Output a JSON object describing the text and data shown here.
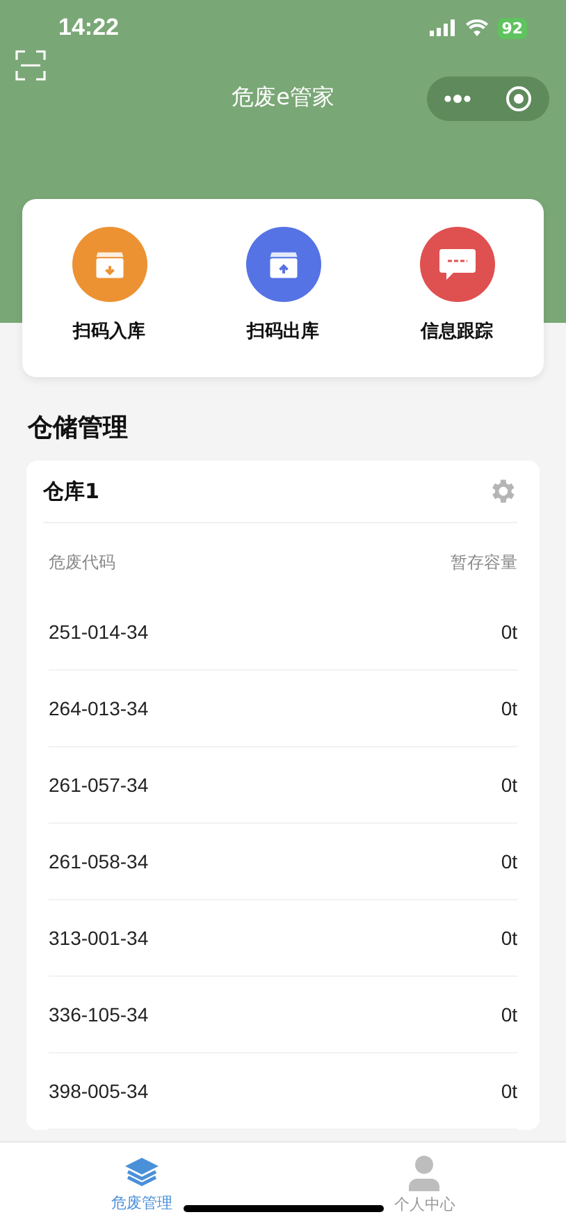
{
  "status_bar": {
    "time": "14:22",
    "battery": "92"
  },
  "header": {
    "title": "危废e管家"
  },
  "actions": [
    {
      "label": "扫码入库",
      "kind": "in",
      "color": "#ec9233"
    },
    {
      "label": "扫码出库",
      "kind": "out",
      "color": "#5573e4"
    },
    {
      "label": "信息跟踪",
      "kind": "message",
      "color": "#df5050"
    }
  ],
  "section_title": "仓储管理",
  "warehouse": {
    "name": "仓库1",
    "columns": [
      "危废代码",
      "暂存容量"
    ],
    "rows": [
      [
        "251-014-34",
        "0t"
      ],
      [
        "264-013-34",
        "0t"
      ],
      [
        "261-057-34",
        "0t"
      ],
      [
        "261-058-34",
        "0t"
      ],
      [
        "313-001-34",
        "0t"
      ],
      [
        "336-105-34",
        "0t"
      ],
      [
        "398-005-34",
        "0t"
      ]
    ]
  },
  "tab_bar": [
    {
      "label": "危废管理",
      "kind": "layers",
      "selected": true
    },
    {
      "label": "个人中心",
      "kind": "person",
      "selected": false
    }
  ]
}
